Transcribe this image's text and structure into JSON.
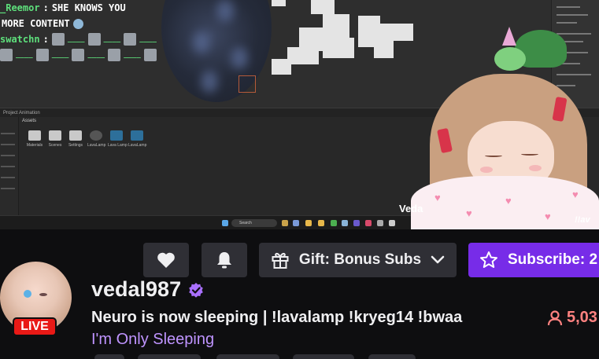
{
  "stream": {
    "chat": [
      {
        "user": "_Reemor",
        "text": "SHE KNOWS YOU"
      },
      {
        "user": "",
        "text": "MORE CONTENT"
      },
      {
        "user": "swatchn",
        "text": ""
      }
    ],
    "overlay_mark": "Veda",
    "overlay_mark_right": "!!av",
    "editor_tabs": "Project   Animation",
    "assets_header": "Assets",
    "assets": [
      "Materials",
      "Scenes",
      "Settings",
      "LavaLamp",
      "Lava Lamp",
      "LavaLamp"
    ],
    "taskbar_search": "Search"
  },
  "actions": {
    "follow_icon": "heart-icon",
    "notify_icon": "bell-icon",
    "gift_label": "Gift: Bonus Subs",
    "subscribe_label": "Subscribe: 2",
    "colors": {
      "button_bg": "#2f2f35",
      "subscribe_bg": "#772ce8"
    }
  },
  "channel": {
    "live_badge": "LIVE",
    "name": "vedal987",
    "title": "Neuro is now sleeping | !lavalamp !kryeg14 !bwaa",
    "category": "I'm Only Sleeping",
    "viewers": "5,03",
    "colors": {
      "live": "#e91916",
      "category": "#bf94ff",
      "viewers": "#ff8280",
      "verified": "#a970ff"
    }
  }
}
